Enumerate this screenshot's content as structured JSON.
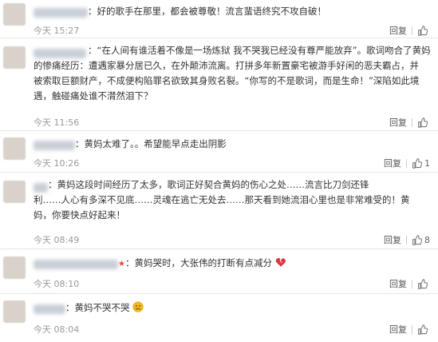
{
  "comments": [
    {
      "lines": [
        "：好的歌手在那里，都会被尊敬！流言蜚语终究不攻自破！"
      ],
      "time": "今天 15:27",
      "reply": "回复",
      "likes": ""
    },
    {
      "lines": [
        "：“在人间有谁活着不像是一场炼狱 我不哭我已经没有尊严能放弃”。歌词吻合了黄妈",
        "的惨痛经历：遭遇家暴分居已久，在外颠沛流离。打拼多年新置豪宅被游手好闲的恶夫霸占，并",
        "被索取巨额财产，不成便构陷罪名欲致其身败名裂。“你写的不是歌词，而是生命！”深陷如此境",
        "遇，触碰痛处谁不潸然泪下？"
      ],
      "time": "今天 11:56",
      "reply": "回复",
      "likes": ""
    },
    {
      "lines": [
        "：黄妈太难了。。希望能早点走出阴影"
      ],
      "time": "今天 10:26",
      "reply": "回复",
      "likes": "1"
    },
    {
      "lines": [
        "：黄妈这段时间经历了太多，歌词正好契合黄妈的伤心之处……流言比刀剑还锋",
        "利……人心有多深不见底……灵魂在逃亡无处去……那天看到她流泪心里也是非常难受的！黄",
        "妈，你要快点好起来！"
      ],
      "time": "今天 08:49",
      "reply": "回复",
      "likes": "8"
    },
    {
      "lines": [
        "：黄妈哭时，大张伟的打断有点减分"
      ],
      "time": "今天 08:10",
      "reply": "回复",
      "likes": "",
      "emoji": "broken-heart"
    },
    {
      "lines": [
        "：黄妈不哭不哭"
      ],
      "time": "今天 08:04",
      "reply": "回复",
      "likes": "",
      "emoji": "sad-face"
    }
  ],
  "colors": {
    "text": "#333333",
    "meta": "#9a9a9a",
    "divider": "#e6e6e6",
    "broken_heart": "#d9363e",
    "sad_face": "#f5b920"
  }
}
